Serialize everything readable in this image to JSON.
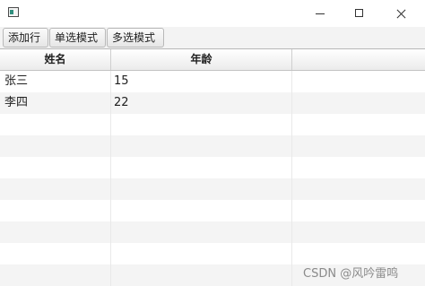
{
  "toolbar": {
    "add_row": "添加行",
    "single_select": "单选模式",
    "multi_select": "多选模式"
  },
  "table": {
    "columns": [
      "姓名",
      "年龄",
      ""
    ],
    "rows": [
      {
        "name": "张三",
        "age": "15"
      },
      {
        "name": "李四",
        "age": "22"
      }
    ]
  },
  "watermark": "CSDN @风吟雷鸣"
}
